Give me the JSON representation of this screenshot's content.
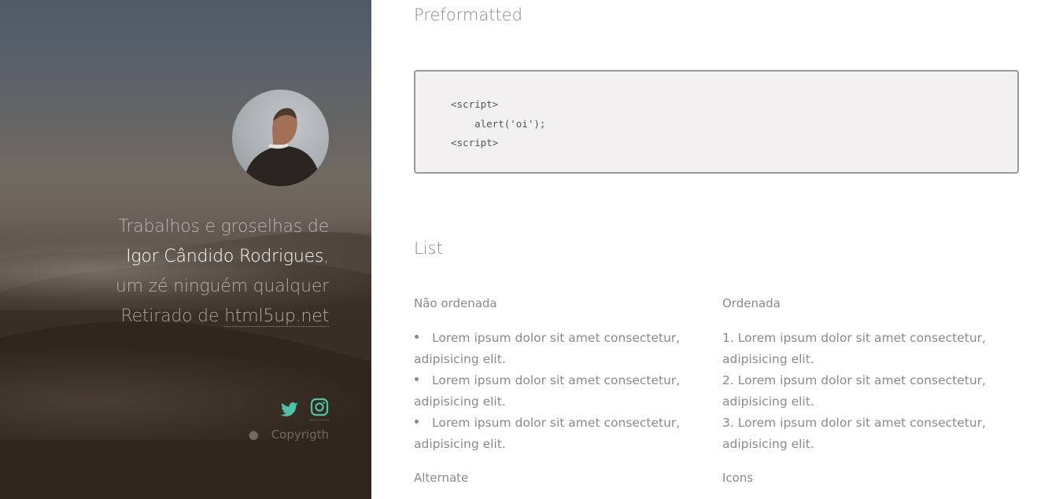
{
  "sidebar": {
    "intro_line1": "Trabalhos e groselhas de",
    "intro_name": "Igor Cândido Rodrigues",
    "intro_comma": ",",
    "intro_line3": "um zé ninguém qualquer",
    "intro_prefix": "Retirado de ",
    "intro_link": "html5up.net",
    "social": [
      {
        "icon": "twitter-icon",
        "color": "#4fc1a6"
      },
      {
        "icon": "instagram-icon",
        "color": "#4fc1a6"
      }
    ],
    "copyright": "Copyrigth"
  },
  "main": {
    "preformatted": {
      "heading": "Preformatted",
      "code_lines": [
        "<script>",
        "    alert('oi');",
        "<script>"
      ]
    },
    "list": {
      "heading": "List",
      "unordered": {
        "heading": "Não ordenada",
        "items": [
          {
            "line1": "Lorem ipsum dolor sit amet consectetur,",
            "line2": "adipisicing elit."
          },
          {
            "line1": "Lorem ipsum dolor sit amet consectetur,",
            "line2": "adipisicing elit."
          },
          {
            "line1": "Lorem ipsum dolor sit amet consectetur,",
            "line2": "adipisicing elit."
          }
        ]
      },
      "ordered": {
        "heading": "Ordenada",
        "items": [
          {
            "line1": "1. Lorem ipsum dolor sit amet consectetur,",
            "line2": "adipisicing elit."
          },
          {
            "line1": "2. Lorem ipsum dolor sit amet consectetur,",
            "line2": "adipisicing elit."
          },
          {
            "line1": "3. Lorem ipsum dolor sit amet consectetur,",
            "line2": "adipisicing elit."
          }
        ]
      },
      "alternate_heading": "Alternate",
      "icons_heading": "Icons"
    }
  },
  "colors": {
    "accent": "#4fc1a6",
    "text": "#8a8a8a",
    "pre_background": "#f2f0f1",
    "pre_border": "#9a9a9a"
  }
}
